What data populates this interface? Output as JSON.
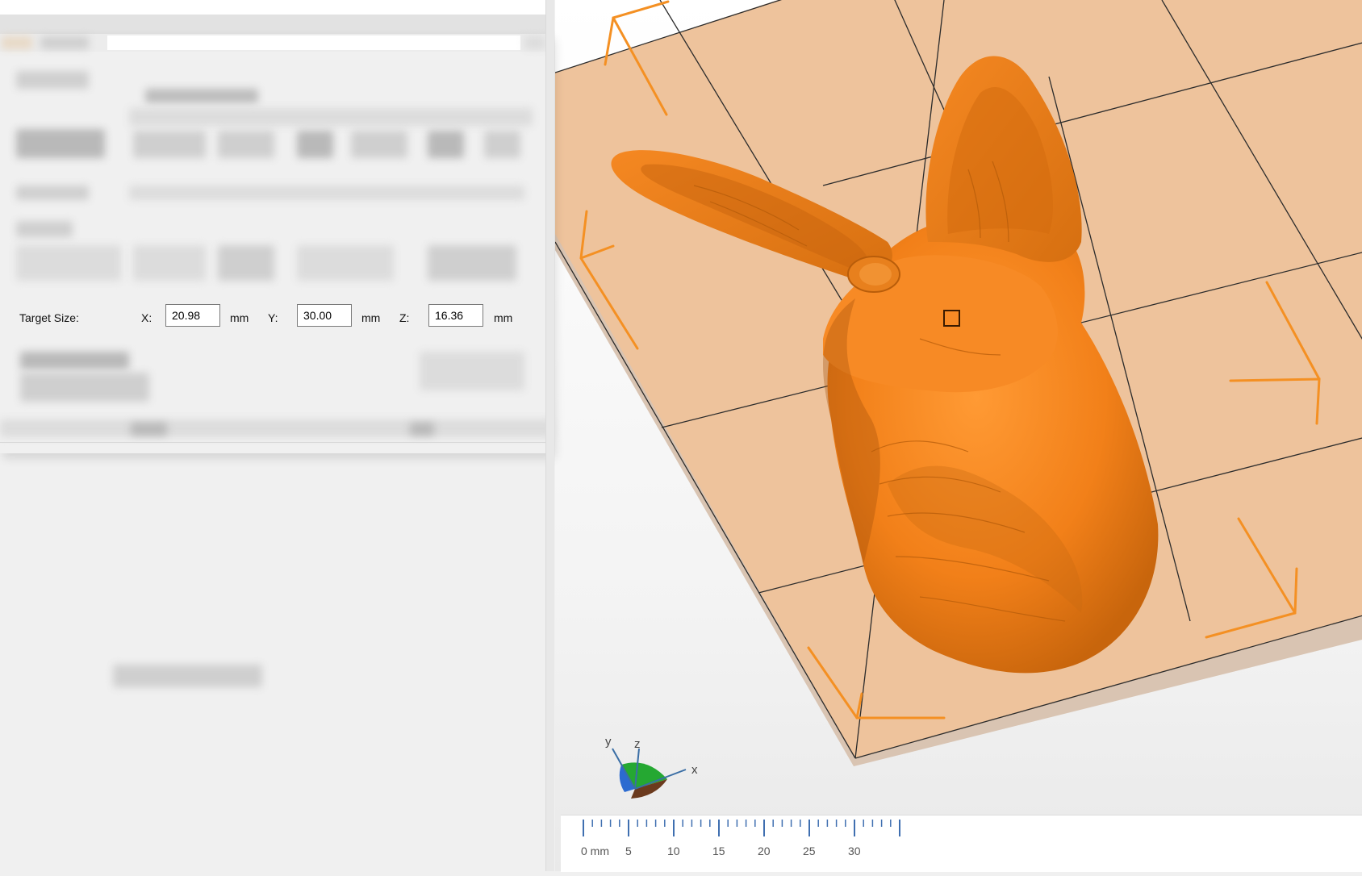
{
  "target_size": {
    "label": "Target Size:",
    "x": {
      "label": "X:",
      "value": "20.98",
      "unit": "mm"
    },
    "y": {
      "label": "Y:",
      "value": "30.00",
      "unit": "mm"
    },
    "z": {
      "label": "Z:",
      "value": "16.36",
      "unit": "mm"
    }
  },
  "ruler": {
    "ticks": [
      {
        "label": "0 mm",
        "value": 0
      },
      {
        "label": "5",
        "value": 5
      },
      {
        "label": "10",
        "value": 10
      },
      {
        "label": "15",
        "value": 15
      },
      {
        "label": "20",
        "value": 20
      },
      {
        "label": "25",
        "value": 25
      },
      {
        "label": "30",
        "value": 30
      }
    ]
  },
  "axis_gizmo": {
    "x": "x",
    "y": "y",
    "z": "z"
  },
  "colors": {
    "model": "#f7861f",
    "model_shadow": "#a14d08",
    "bed": "#eec39c",
    "bed_marker": "#f49023",
    "grid_line": "#2b2b2b"
  }
}
